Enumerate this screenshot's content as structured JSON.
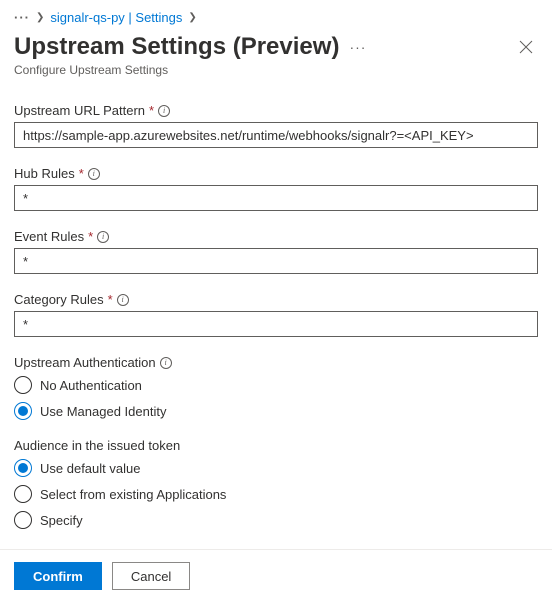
{
  "breadcrumb": {
    "resource": "signalr-qs-py | Settings"
  },
  "header": {
    "title": "Upstream Settings (Preview)",
    "subtitle": "Configure Upstream Settings"
  },
  "fields": {
    "url_pattern": {
      "label": "Upstream URL Pattern",
      "value": "https://sample-app.azurewebsites.net/runtime/webhooks/signalr?=<API_KEY>"
    },
    "hub_rules": {
      "label": "Hub Rules",
      "value": "*"
    },
    "event_rules": {
      "label": "Event Rules",
      "value": "*"
    },
    "category_rules": {
      "label": "Category Rules",
      "value": "*"
    }
  },
  "auth": {
    "label": "Upstream Authentication",
    "options": {
      "none": "No Authentication",
      "managed": "Use Managed Identity"
    },
    "selected": "managed"
  },
  "audience": {
    "label": "Audience in the issued token",
    "options": {
      "default": "Use default value",
      "existing": "Select from existing Applications",
      "specify": "Specify"
    },
    "selected": "default"
  },
  "footer": {
    "confirm": "Confirm",
    "cancel": "Cancel"
  }
}
